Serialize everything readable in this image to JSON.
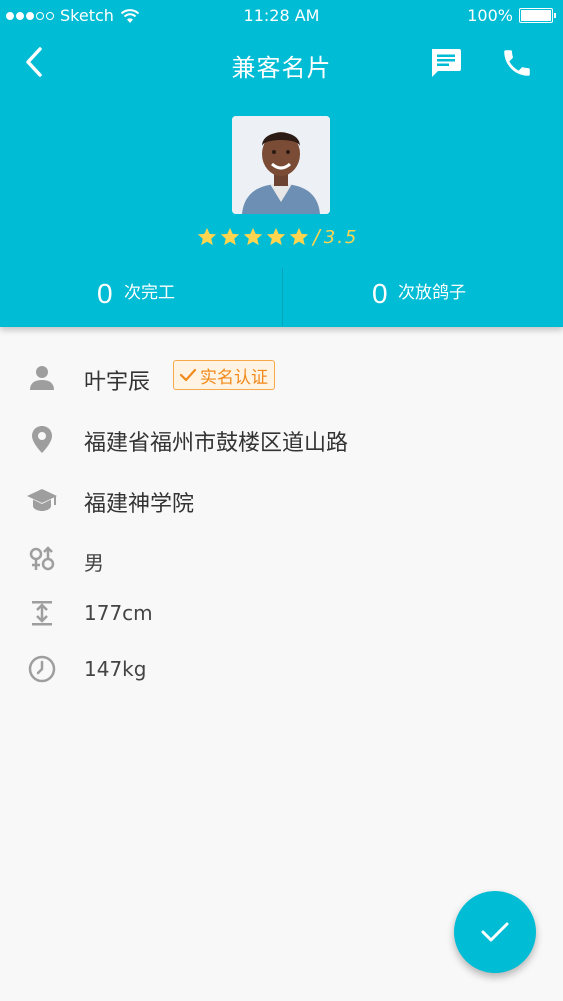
{
  "status_bar": {
    "carrier": "Sketch",
    "time": "11:28 AM",
    "battery": "100%"
  },
  "nav": {
    "title": "兼客名片"
  },
  "profile": {
    "rating_separator": "/",
    "rating_value": "3.5",
    "stars_filled": 5
  },
  "stats": {
    "completed_count": "0",
    "completed_label": "次完工",
    "noshow_count": "0",
    "noshow_label": "次放鸽子"
  },
  "info": {
    "name": "叶宇辰",
    "verified_label": "实名认证",
    "address": "福建省福州市鼓楼区道山路",
    "school": "福建神学院",
    "gender": "男",
    "height": "177cm",
    "weight": "147kg"
  },
  "colors": {
    "primary": "#00bcd4",
    "star": "#ffd54f",
    "badge": "#f7a84a"
  }
}
